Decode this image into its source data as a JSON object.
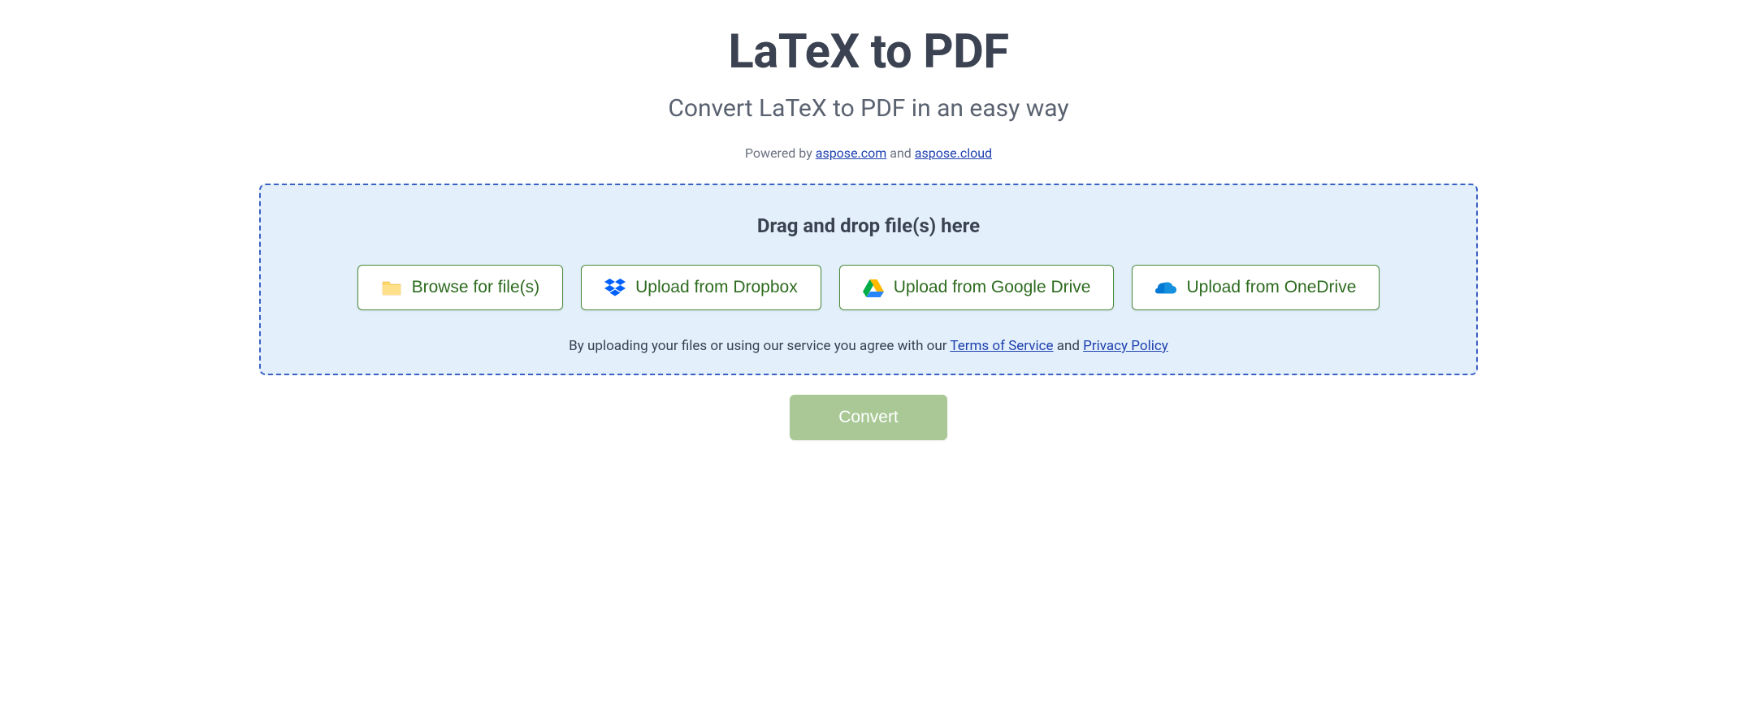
{
  "header": {
    "title": "LaTeX to PDF",
    "subtitle": "Convert LaTeX to PDF in an easy way",
    "powered_prefix": "Powered by ",
    "powered_link1": "aspose.com",
    "powered_mid": " and ",
    "powered_link2": "aspose.cloud"
  },
  "dropzone": {
    "drop_text": "Drag and drop file(s) here",
    "buttons": {
      "browse": "Browse for file(s)",
      "dropbox": "Upload from Dropbox",
      "gdrive": "Upload from Google Drive",
      "onedrive": "Upload from OneDrive"
    },
    "agreement_prefix": "By uploading your files or using our service you agree with our ",
    "terms_link": "Terms of Service",
    "agreement_mid": " and ",
    "privacy_link": "Privacy Policy"
  },
  "actions": {
    "convert": "Convert"
  }
}
